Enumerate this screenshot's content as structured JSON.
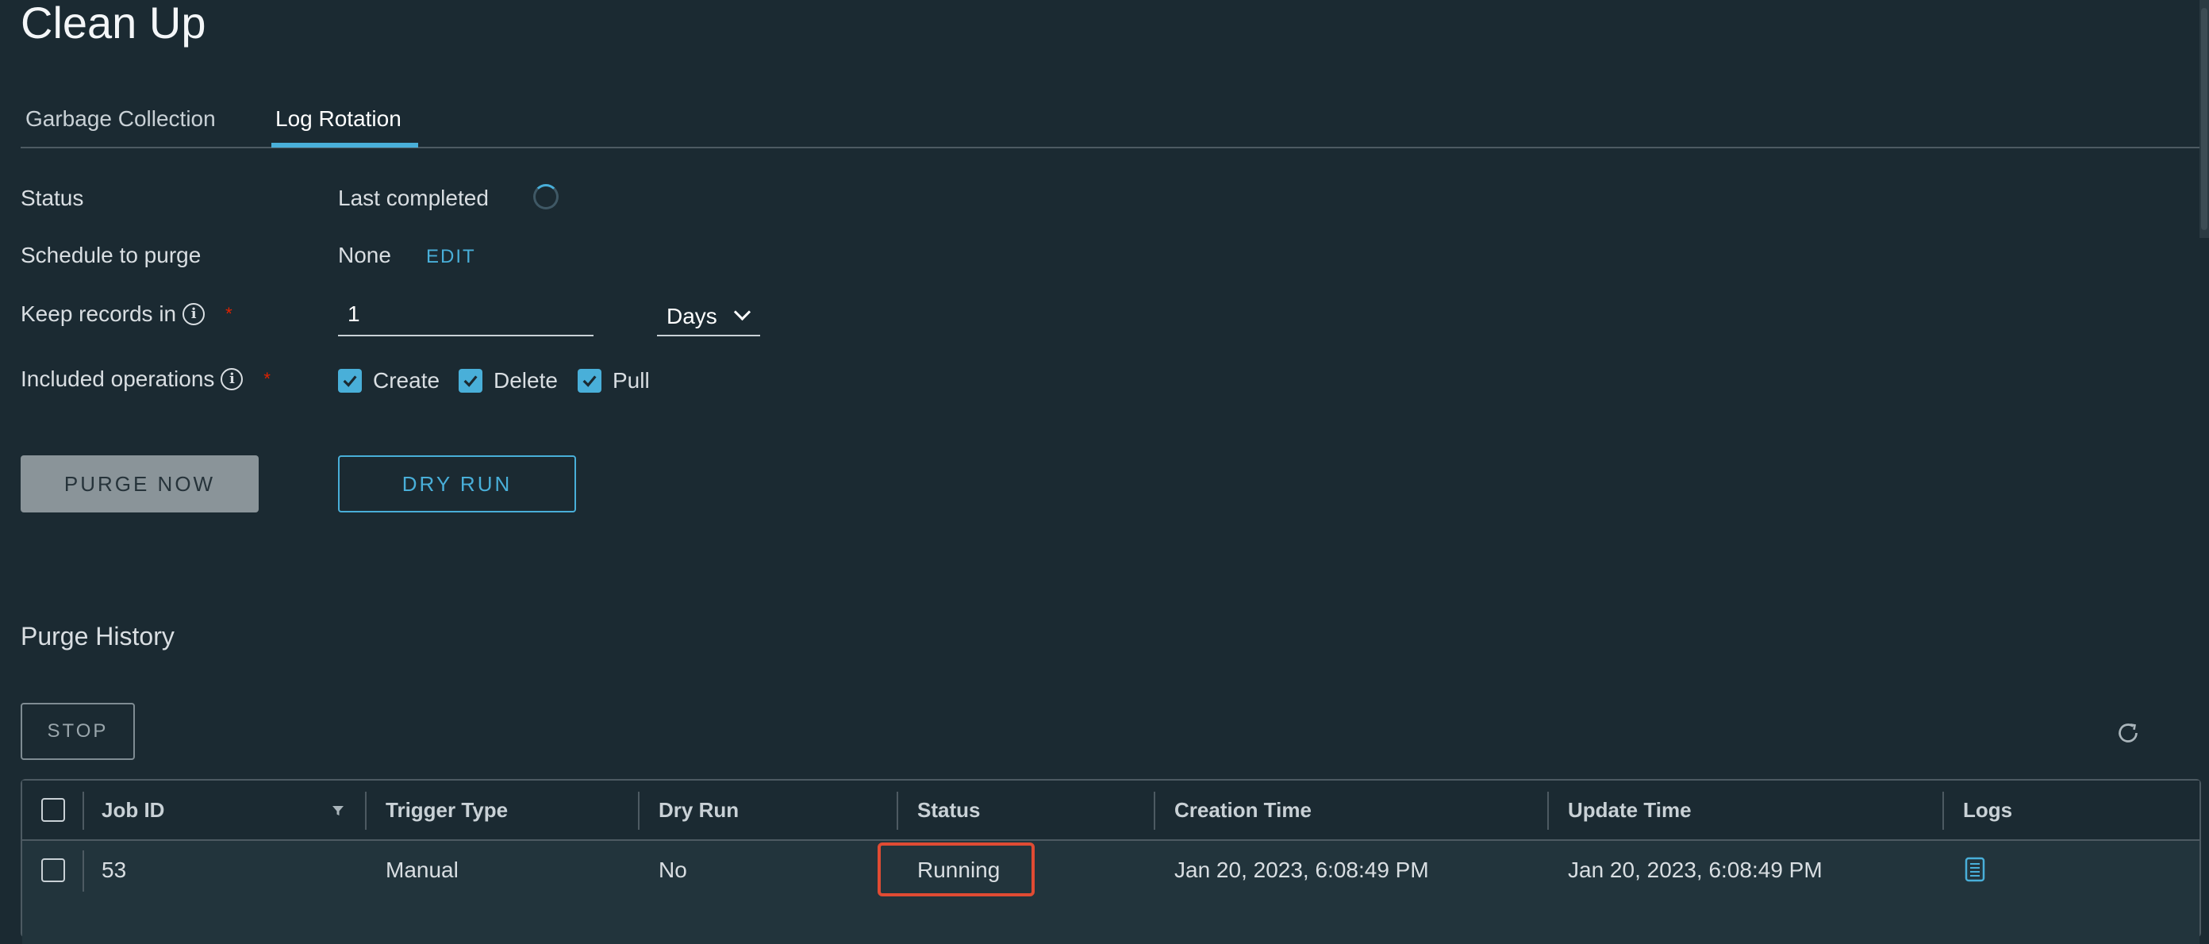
{
  "page": {
    "title": "Clean Up"
  },
  "tabs": [
    {
      "label": "Garbage Collection"
    },
    {
      "label": "Log Rotation"
    }
  ],
  "form": {
    "status_label": "Status",
    "status_value": "Last completed",
    "schedule_label": "Schedule to purge",
    "schedule_value": "None",
    "edit_label": "EDIT",
    "keep_label": "Keep records in",
    "keep_value": "1",
    "keep_unit": "Days",
    "ops_label": "Included operations",
    "required_mark": "*",
    "info_glyph": "i",
    "operations": [
      {
        "label": "Create",
        "checked": true
      },
      {
        "label": "Delete",
        "checked": true
      },
      {
        "label": "Pull",
        "checked": true
      }
    ]
  },
  "buttons": {
    "purge_now": "PURGE NOW",
    "dry_run": "DRY RUN",
    "stop": "STOP"
  },
  "history": {
    "title": "Purge History",
    "columns": [
      "Job ID",
      "Trigger Type",
      "Dry Run",
      "Status",
      "Creation Time",
      "Update Time",
      "Logs"
    ],
    "rows": [
      {
        "job_id": "53",
        "trigger_type": "Manual",
        "dry_run": "No",
        "status": "Running",
        "creation_time": "Jan 20, 2023, 6:08:49 PM",
        "update_time": "Jan 20, 2023, 6:08:49 PM"
      }
    ]
  },
  "colors": {
    "background": "#1b2a32",
    "accent": "#49afd9",
    "highlight": "#e04b33",
    "required": "#e02200"
  },
  "icons": [
    "info-icon",
    "spinner-icon",
    "chevron-down-icon",
    "checkmark-icon",
    "filter-icon",
    "refresh-icon",
    "log-file-icon"
  ]
}
